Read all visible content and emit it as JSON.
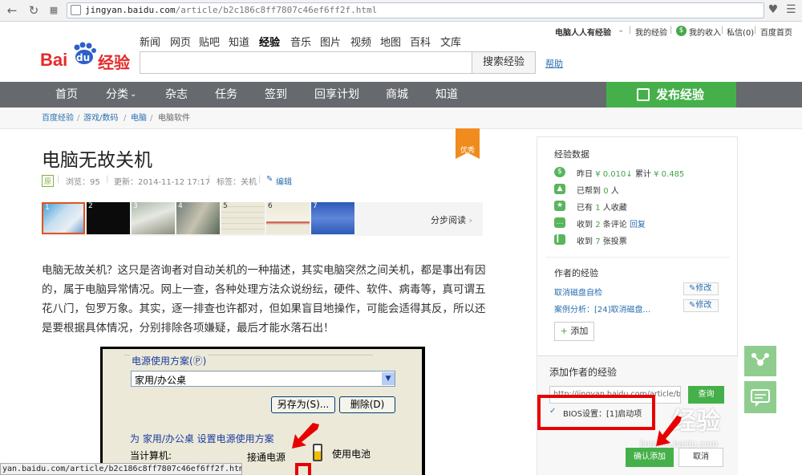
{
  "browser": {
    "url_host": "jingyan.baidu.com",
    "url_path": "/article/b2c186c8ff7807c46ef6ff2f.html",
    "status_url": "yan.baidu.com/article/b2c186c8ff7807c46ef6ff2f.html#"
  },
  "header": {
    "logo_bai": "Bai",
    "logo_du": "du",
    "logo_jy": "经验",
    "topnav": [
      "新闻",
      "网页",
      "贴吧",
      "知道",
      "经验",
      "音乐",
      "图片",
      "视频",
      "地图",
      "百科",
      "文库"
    ],
    "search_placeholder": "",
    "search_button": "搜索经验",
    "help": "帮助",
    "user": {
      "name": "电脑人人有经验",
      "my_exp": "我的经验",
      "my_income": "我的收入",
      "messages": "私信(0)",
      "home": "百度首页",
      "sep": "|"
    }
  },
  "mainnav": {
    "items": [
      "首页",
      "分类",
      "杂志",
      "任务",
      "签到",
      "回享计划",
      "商城",
      "知道"
    ],
    "publish": "发布经验"
  },
  "breadcrumb": [
    "百度经验",
    "游戏/数码",
    "电脑",
    "电脑软件"
  ],
  "article": {
    "title": "电脑无故关机",
    "badge": "优秀",
    "yuan": "原",
    "views": "浏览：95",
    "updated": "更新：2014-11-12 17:17",
    "tags": "标签：关机",
    "edit": "编辑",
    "thumbs": [
      "1",
      "2",
      "3",
      "4",
      "5",
      "6",
      "7"
    ],
    "step_read": "分步阅读",
    "body": "电脑无故关机？这只是咨询者对自动关机的一种描述，其实电脑突然之间关机，都是事出有因的，属于电脑异常情况。网上一查，各种处理方法众说纷纭，硬件、软件、病毒等，真可谓五花八门，包罗万象。其实，逐一排查也许都对，但如果盲目地操作，可能会适得其反，所以还是要根据具体情况，分别排除各项嫌疑，最后才能水落石出！",
    "screenshot": {
      "scheme_label": "电源使用方案(Ⓟ)",
      "scheme_value": "家用/办公桌",
      "save_as": "另存为(S)...",
      "delete": "删除(D)",
      "settings_label": "为 家用/办公桌 设置电源使用方案",
      "computer": "当计算机:",
      "plugged": "接通电源",
      "battery": "使用电池"
    }
  },
  "sidebar": {
    "stats_title": "经验数据",
    "yesterday_label": "昨日",
    "yesterday_value": "¥ 0.010",
    "total_label": "累计",
    "total_value": "¥ 0.485",
    "helped_prefix": "已帮到",
    "helped_count": "0",
    "helped_suffix": "人",
    "fav_prefix": "已有",
    "fav_count": "1",
    "fav_suffix": "人收藏",
    "comments_prefix": "收到",
    "comments_count": "2",
    "comments_suffix": "条评论",
    "reply": "回复",
    "votes_prefix": "收到",
    "votes_count": "7",
    "votes_suffix": "张投票",
    "author_title": "作者的经验",
    "author_items": [
      "取消磁盘自检",
      "案例分析：[24]取消磁盘..."
    ],
    "modify": "修改",
    "add": "添加",
    "popup_title": "添加作者的经验",
    "popup_url": "http://jingyan.baidu.com/article/b",
    "query": "查询",
    "bios_item": "BIOS设置：[1]启动项",
    "confirm": "确认添加",
    "cancel": "取消"
  },
  "watermark": {
    "line1": "经验",
    "line2": "jingyan.baidu.com"
  },
  "colors": {
    "brand_red": "#e52a2a",
    "accent_green": "#45b04a",
    "nav_gray": "#666a6e",
    "highlight_red": "#e80000"
  }
}
